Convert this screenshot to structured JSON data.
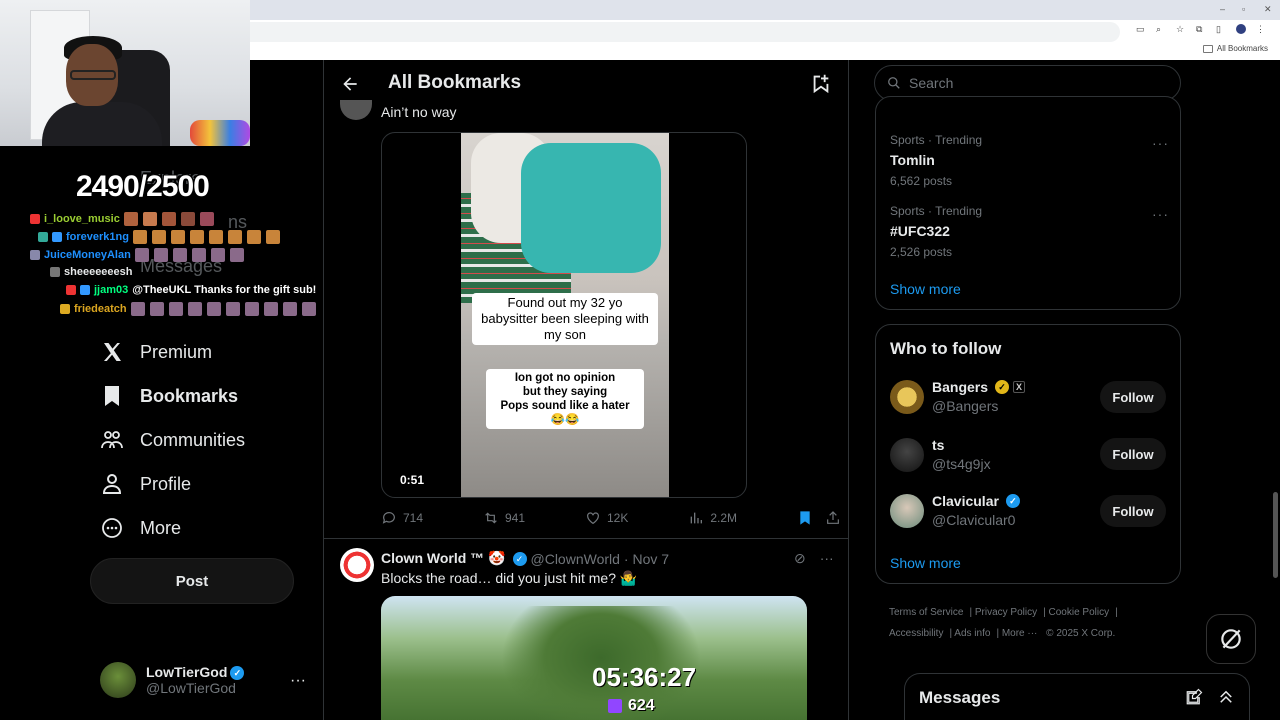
{
  "browser": {
    "bookmark_folder": "All Bookmarks",
    "window_controls": [
      "–",
      "▫",
      "✕"
    ]
  },
  "stream_overlay": {
    "sub_goal": "2490/2500",
    "chat": [
      {
        "user": "i_loove_music",
        "color": "#9acd32",
        "message": ""
      },
      {
        "user": "foreverk1ng",
        "color": "#1e90ff",
        "message": ""
      },
      {
        "user": "JuiceMoneyAlan",
        "color": "#1e90ff",
        "message": ""
      },
      {
        "user": "",
        "color": "#888888",
        "message": "sheeeeeeesh"
      },
      {
        "user": "jjam03",
        "color": "#00ff7f",
        "message": "@TheeUKL Thanks for the gift sub!"
      },
      {
        "user": "friedeatch",
        "color": "#daa520",
        "message": ""
      }
    ],
    "timer": "05:36:27",
    "viewers": "624"
  },
  "leftnav": {
    "ghost_explore": "Explore",
    "ghost_messages": "Messages",
    "ghost_ns": "ns",
    "items": [
      {
        "label": "Premium",
        "icon": "x-logo-icon"
      },
      {
        "label": "Bookmarks",
        "icon": "bookmark-icon"
      },
      {
        "label": "Communities",
        "icon": "communities-icon"
      },
      {
        "label": "Profile",
        "icon": "profile-icon"
      },
      {
        "label": "More",
        "icon": "more-circle-icon"
      }
    ],
    "post_label": "Post",
    "account": {
      "name": "LowTierGod",
      "handle": "@LowTierGod"
    }
  },
  "main": {
    "title": "All Bookmarks",
    "tweet1": {
      "text": "Ain’t no way",
      "caption_top": "Found out my 32 yo\nbabysitter been sleeping with\nmy son",
      "caption_bottom": "Ion got no opinion\nbut they saying\nPops sound like a hater 😂😂",
      "duration": "0:51",
      "replies": "714",
      "reposts": "941",
      "likes": "12K",
      "views": "2.2M"
    },
    "tweet2": {
      "name": "Clown World ™ 🤡",
      "handle": "@ClownWorld",
      "date": "· Nov 7",
      "text": "Blocks the road… did you just hit me? 🤷‍♂️"
    }
  },
  "sidebar": {
    "search_placeholder": "Search",
    "trends": [
      {
        "category": "Sports · Trending",
        "name": "Tomlin",
        "posts": "6,562 posts"
      },
      {
        "category": "Sports · Trending",
        "name": "#UFC322",
        "posts": "2,526 posts"
      }
    ],
    "show_more": "Show more",
    "who_to_follow_title": "Who to follow",
    "follow": [
      {
        "name": "Bangers",
        "handle": "@Bangers",
        "badge": "gold"
      },
      {
        "name": "ts",
        "handle": "@ts4g9jx",
        "badge": "none"
      },
      {
        "name": "Clavicular",
        "handle": "@Clavicular0",
        "badge": "blue"
      }
    ],
    "follow_label": "Follow",
    "footer": [
      "Terms of Service",
      "Privacy Policy",
      "Cookie Policy",
      "Accessibility",
      "Ads info",
      "More ···",
      "© 2025 X Corp."
    ],
    "messages_title": "Messages"
  }
}
